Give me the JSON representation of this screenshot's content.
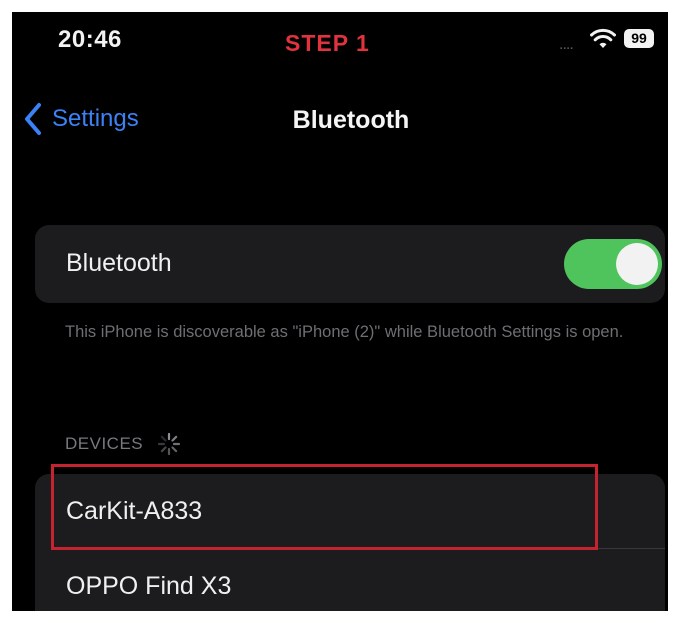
{
  "status_bar": {
    "time": "20:46",
    "step_label": "STEP 1",
    "signal_dots": "....",
    "battery_level": "99",
    "wifi_icon": "wifi-icon"
  },
  "nav": {
    "back_label": "Settings",
    "title": "Bluetooth",
    "back_icon": "chevron-left-icon"
  },
  "bluetooth": {
    "label": "Bluetooth",
    "enabled": true,
    "toggle_color": "#4fc35c",
    "footnote": "This iPhone is discoverable as \"iPhone (2)\" while Bluetooth Settings is open."
  },
  "devices": {
    "header": "DEVICES",
    "spinner_icon": "loading-spinner-icon",
    "items": [
      {
        "name": "CarKit-A833"
      },
      {
        "name": "OPPO Find X3"
      }
    ]
  },
  "colors": {
    "accent": "#3b82f6",
    "highlight": "#c4232f",
    "background": "#000000",
    "card": "#1c1c1e"
  }
}
